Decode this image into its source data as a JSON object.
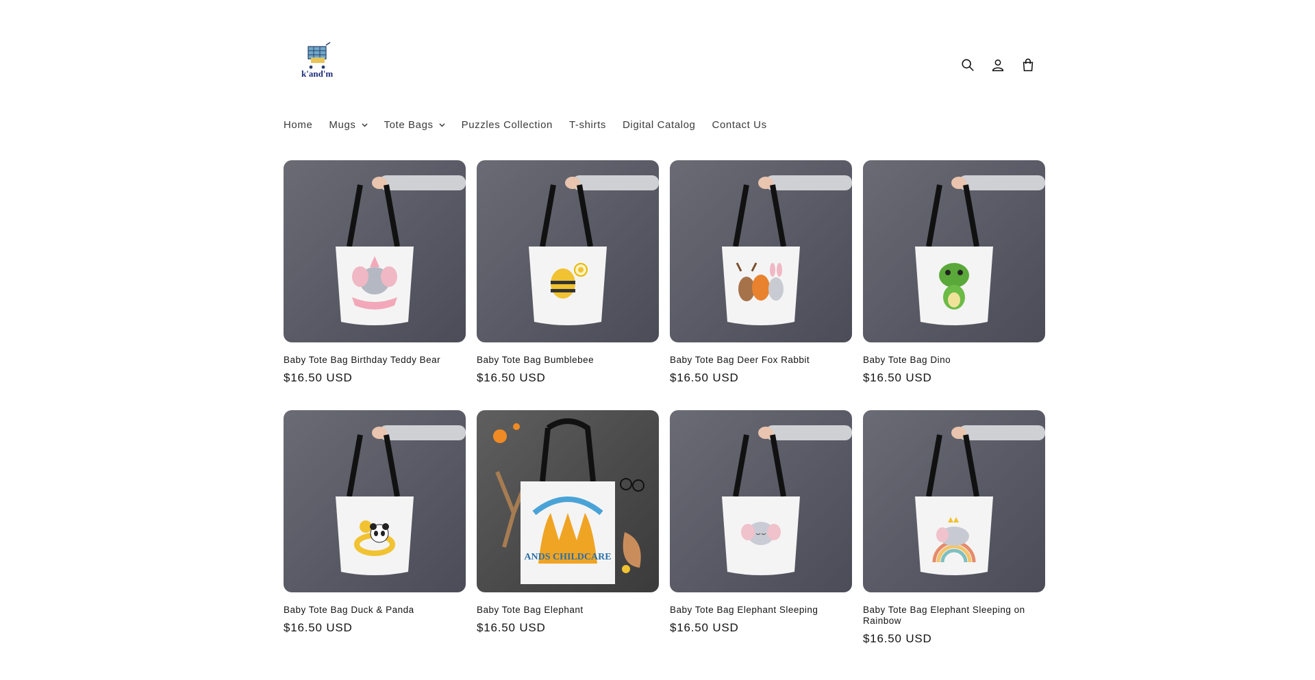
{
  "header": {
    "logo_text": "k'and'm",
    "icons": [
      "search-icon",
      "account-icon",
      "cart-icon"
    ]
  },
  "nav": {
    "items": [
      {
        "label": "Home",
        "dropdown": false
      },
      {
        "label": "Mugs",
        "dropdown": true
      },
      {
        "label": "Tote Bags",
        "dropdown": true
      },
      {
        "label": "Puzzles Collection",
        "dropdown": false
      },
      {
        "label": "T-shirts",
        "dropdown": false
      },
      {
        "label": "Digital Catalog",
        "dropdown": false
      },
      {
        "label": "Contact Us",
        "dropdown": false
      }
    ]
  },
  "products": [
    {
      "title": "Baby Tote Bag Birthday Teddy Bear",
      "price": "$16.50 USD",
      "art": "pink-elephant"
    },
    {
      "title": "Baby Tote Bag Bumblebee",
      "price": "$16.50 USD",
      "art": "bee"
    },
    {
      "title": "Baby Tote Bag Deer Fox Rabbit",
      "price": "$16.50 USD",
      "art": "deer-fox-rabbit"
    },
    {
      "title": "Baby Tote Bag Dino",
      "price": "$16.50 USD",
      "art": "dino"
    },
    {
      "title": "Baby Tote Bag Duck & Panda",
      "price": "$16.50 USD",
      "art": "duck-panda"
    },
    {
      "title": "Baby Tote Bag Elephant",
      "price": "$16.50 USD",
      "art": "childcare-logo"
    },
    {
      "title": "Baby Tote Bag Elephant Sleeping",
      "price": "$16.50 USD",
      "art": "sleeping-elephant"
    },
    {
      "title": "Baby Tote Bag Elephant Sleeping on Rainbow",
      "price": "$16.50 USD",
      "art": "rainbow-elephant"
    }
  ],
  "colors": {
    "text": "#121212",
    "background": "#ffffff",
    "photo_wall": "#5a5b66"
  }
}
